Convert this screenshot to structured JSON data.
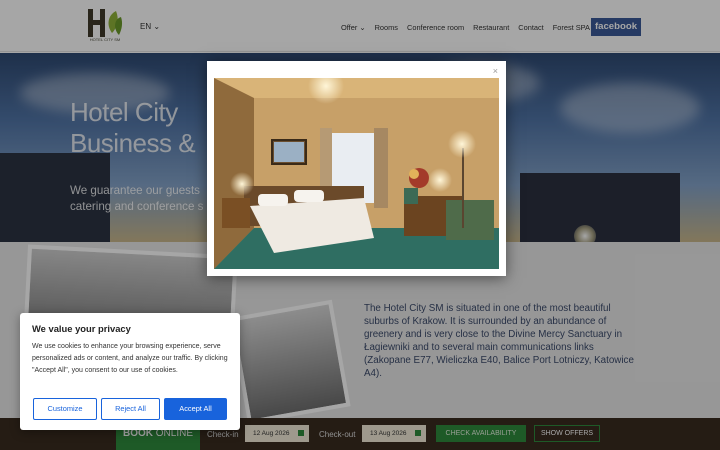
{
  "header": {
    "logo_caption": "HOTEL CITY SM",
    "language": "EN",
    "nav": [
      "Offer",
      "Rooms",
      "Conference room",
      "Restaurant",
      "Contact",
      "Forest SPA"
    ],
    "facebook": "facebook"
  },
  "hero": {
    "title_line1": "Hotel City",
    "title_line2": "Business &",
    "subtitle_line1": "We guarantee our guests",
    "subtitle_line2": "catering and conference s"
  },
  "about": {
    "text": "The Hotel City SM is situated in one of the most beautiful suburbs of Krakow. It is surrounded by an abundance of greenery and is very close to the Divine Mercy Sanctuary in Łagiewniki and to several main communications links (Zakopane E77, Wieliczka E40, Balice Port Lotniczy, Katowice A4)."
  },
  "booking": {
    "book": "BOOK",
    "online": "ONLINE",
    "checkin_label": "Check-in",
    "checkin_value": "12 Aug 2026",
    "checkout_label": "Check-out",
    "checkout_value": "13 Aug 2026",
    "check_availability": "CHECK AVAILABILITY",
    "show_offers": "SHOW OFFERS"
  },
  "cookie": {
    "title": "We value your privacy",
    "text": "We use cookies to enhance your browsing experience, serve personalized ads or content, and analyze our traffic. By clicking \"Accept All\", you consent to our use of cookies.",
    "customize": "Customize",
    "reject": "Reject All",
    "accept": "Accept All"
  },
  "lightbox": {
    "close": "×"
  }
}
